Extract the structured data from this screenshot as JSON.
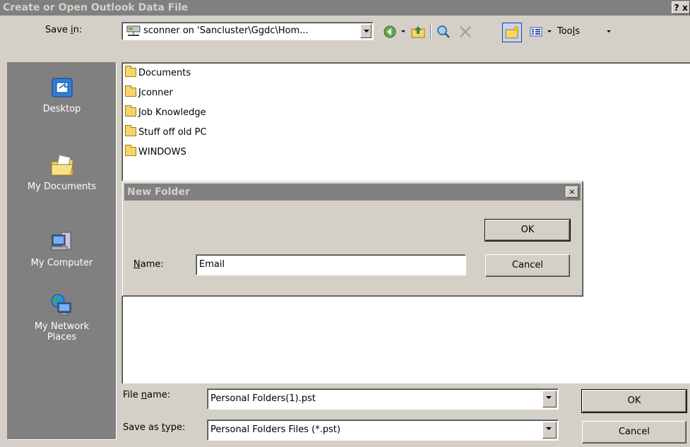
{
  "dialog": {
    "title": "Create or Open Outlook Data File",
    "help_button": "?",
    "close_button": "x"
  },
  "save_in": {
    "label_pre": "Save ",
    "label_accel": "i",
    "label_post": "n:",
    "value": "sconner on 'Sancluster\\Ggdc\\Hom..."
  },
  "toolbar": {
    "tools_pre": "Too",
    "tools_accel": "l",
    "tools_post": "s"
  },
  "places": [
    {
      "label": "Desktop",
      "icon": "desktop-icon"
    },
    {
      "label": "My Documents",
      "icon": "my-documents-icon"
    },
    {
      "label": "My Computer",
      "icon": "my-computer-icon"
    },
    {
      "label": "My Network",
      "label2": "Places",
      "icon": "network-icon"
    }
  ],
  "files": [
    "Documents",
    "Jconner",
    "Job Knowledge",
    "Stuff off old PC",
    "WINDOWS"
  ],
  "new_folder": {
    "title": "New Folder",
    "close": "×",
    "name_label_accel": "N",
    "name_label_rest": "ame:",
    "name_value": "Email",
    "ok_label": "OK",
    "cancel_label": "Cancel"
  },
  "file_name": {
    "label_pre": "File ",
    "label_accel": "n",
    "label_post": "ame:",
    "value": "Personal Folders(1).pst"
  },
  "save_as_type": {
    "label_pre": "Save as ",
    "label_accel": "t",
    "label_post": "ype:",
    "value": "Personal Folders Files (*.pst)"
  },
  "buttons": {
    "ok": "OK",
    "cancel": "Cancel"
  },
  "colors": {
    "titlebar_inactive": "#808080",
    "face": "#d4d0c8",
    "folder": "#f6d56b"
  }
}
